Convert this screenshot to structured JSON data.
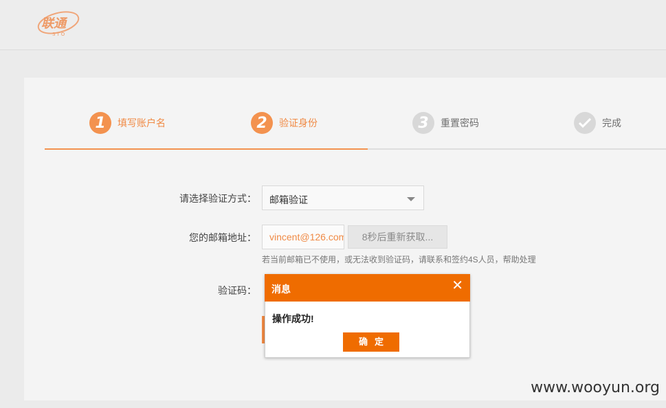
{
  "brand": {
    "logo_text": "联通",
    "logo_subtext": "STO",
    "accent": "#f3924f"
  },
  "steps": [
    {
      "number": "1",
      "label": "填写账户名",
      "state": "done"
    },
    {
      "number": "2",
      "label": "验证身份",
      "state": "active"
    },
    {
      "number": "3",
      "label": "重置密码",
      "state": "pending"
    },
    {
      "icon": "check-icon",
      "label": "完成",
      "state": "pending"
    }
  ],
  "form": {
    "method_label": "请选择验证方式：",
    "method_value": "邮箱验证",
    "email_label": "您的邮箱地址：",
    "email_value": "vincent@126.com",
    "resend_button": "8秒后重新获取...",
    "hint": "若当前邮箱已不使用，或无法收到验证码，请联系和签约4S人员，帮助处理",
    "code_label": "验证码："
  },
  "dialog": {
    "title": "消息",
    "close_glyph": "✕",
    "message": "操作成功!",
    "ok_button": "确定",
    "accent": "#ef6c00"
  },
  "watermark": "www.wooyun.org"
}
